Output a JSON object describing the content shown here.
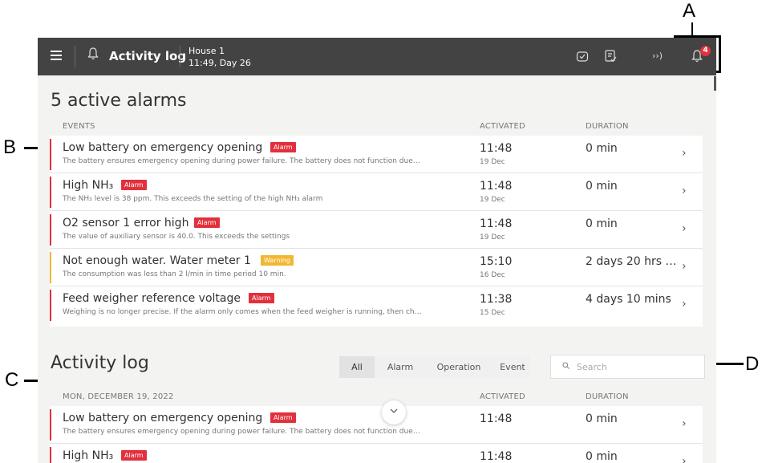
{
  "callouts": {
    "a": "A",
    "b": "B",
    "c": "C",
    "d": "D"
  },
  "topbar": {
    "menu_icon": "hamburger-icon",
    "title_icon": "bell-icon",
    "title": "Activity log",
    "house": "House 1",
    "time": "11:49, Day 26",
    "icons": [
      "shield-check-icon",
      "clipboard-check-icon",
      "signal-icon",
      "bell-icon"
    ],
    "alarm_count": "4"
  },
  "active": {
    "heading": "5 active alarms",
    "col_events": "EVENTS",
    "col_activated": "ACTIVATED",
    "col_duration": "DURATION",
    "rows": [
      {
        "title": "Low battery on emergency opening",
        "tag": "Alarm",
        "desc": "The battery ensures emergency opening during power failure. The battery does not function due…",
        "time": "11:48",
        "date": "19 Dec",
        "duration": "0 min"
      },
      {
        "title": "High NH₃",
        "tag": "Alarm",
        "desc": "The NH₃ level is 38 ppm. This exceeds the setting of the high NH₃ alarm",
        "time": "11:48",
        "date": "19 Dec",
        "duration": "0 min"
      },
      {
        "title": "O2 sensor 1 error high",
        "tag": "Alarm",
        "desc": "The value of auxiliary sensor is 40.0. This exceeds the settings",
        "time": "11:48",
        "date": "19 Dec",
        "duration": "0 min"
      },
      {
        "title": "Not enough water. Water meter 1",
        "tag": "Warning",
        "desc": "The consumption was less than 2 l/min in time period 10 min.",
        "time": "15:10",
        "date": "16 Dec",
        "duration": "2 days 20 hrs …"
      },
      {
        "title": "Feed weigher reference voltage",
        "tag": "Alarm",
        "desc": "Weighing is no longer precise. If the alarm only comes when the feed weigher is running, then ch…",
        "time": "11:38",
        "date": "15 Dec",
        "duration": "4 days 10 mins"
      }
    ],
    "chevron": "›"
  },
  "log": {
    "heading": "Activity log",
    "filters": [
      "All",
      "Alarm",
      "Operation",
      "Event"
    ],
    "search_placeholder": "Search",
    "col_date": "MON, DECEMBER 19, 2022",
    "col_activated": "ACTIVATED",
    "col_duration": "DURATION",
    "rows": [
      {
        "title": "Low battery on emergency opening",
        "tag": "Alarm",
        "desc": "The battery ensures emergency opening during power failure. The battery does not function due…",
        "time": "11:48",
        "duration": "0 min"
      },
      {
        "title": "High NH₃",
        "tag": "Alarm",
        "desc": "",
        "time": "11:48",
        "duration": "0 min"
      }
    ],
    "chevron": "›"
  },
  "colors": {
    "alarm": "#e2303c",
    "warning": "#f2b731",
    "topbar": "#434343"
  }
}
